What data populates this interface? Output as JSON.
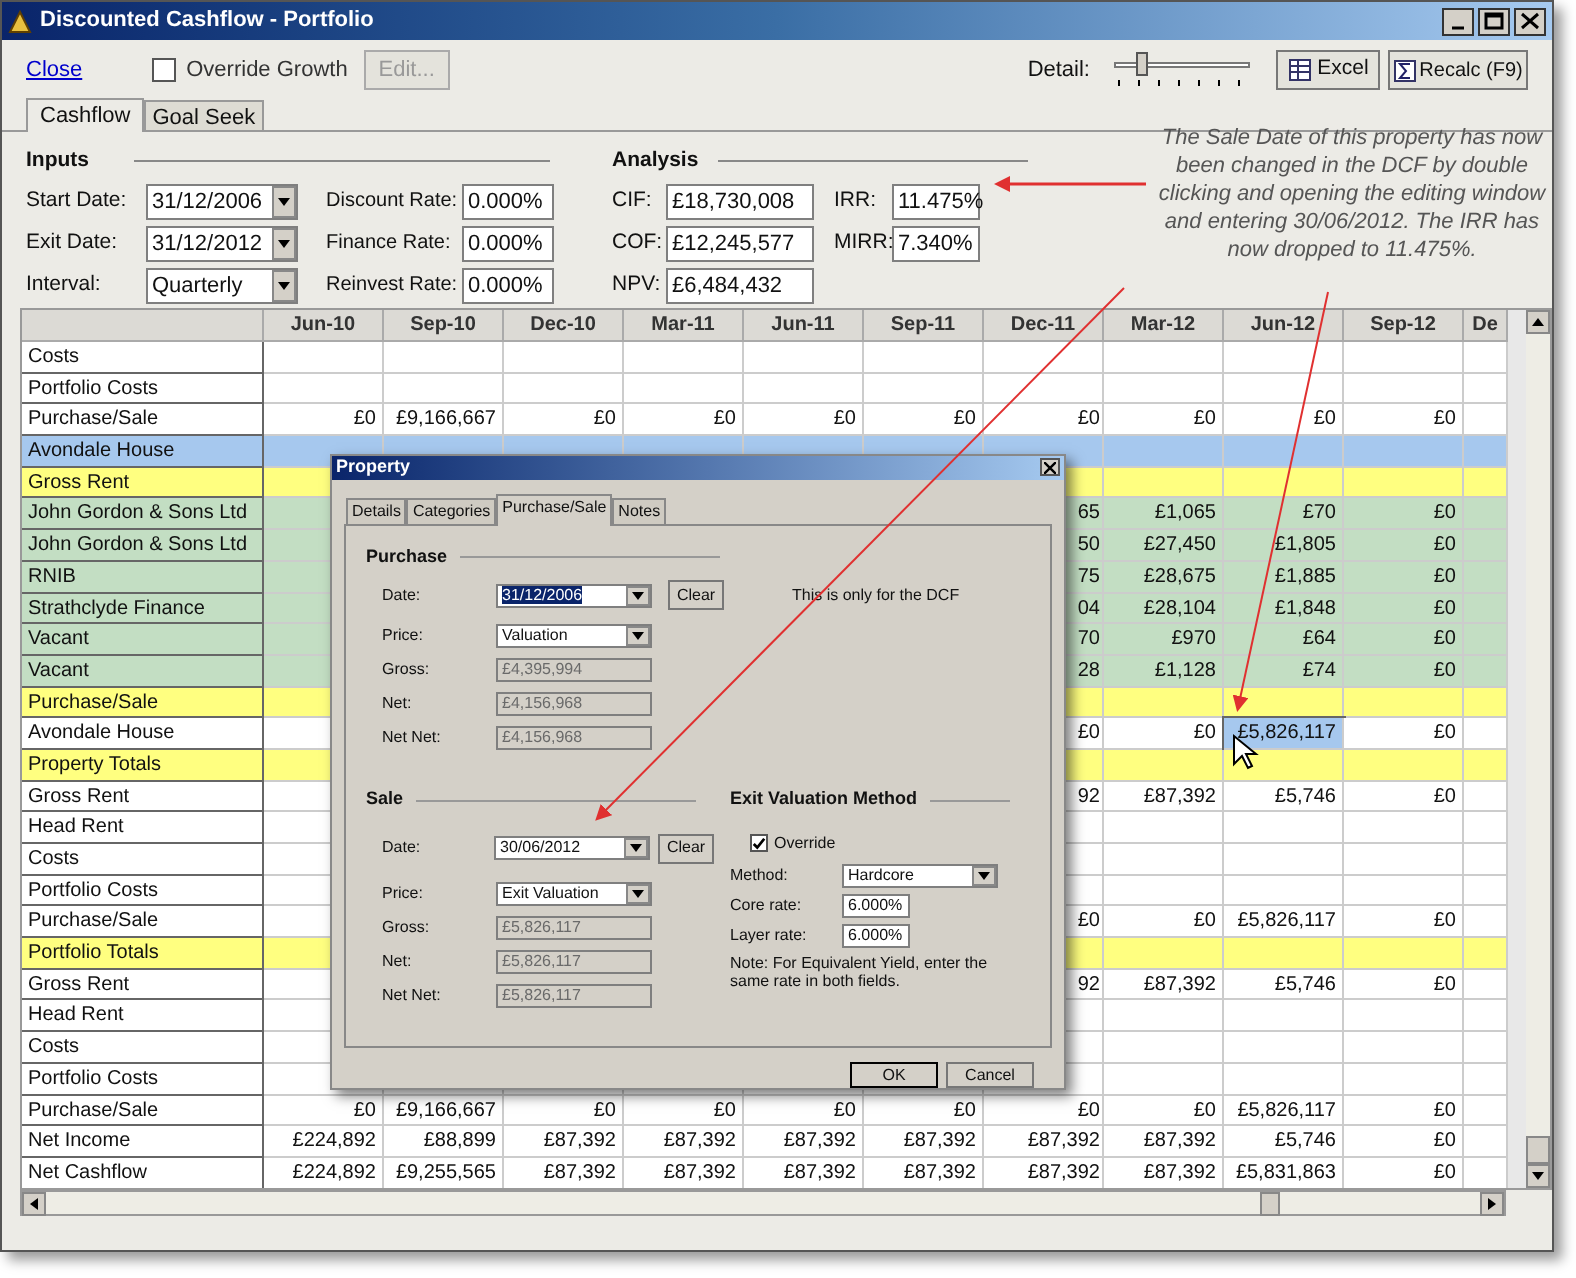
{
  "window": {
    "title": "Discounted Cashflow - Portfolio"
  },
  "toolbar": {
    "close_link": "Close",
    "override_growth": {
      "label": "Override Growth",
      "checked": false
    },
    "edit_button": {
      "label": "Edit...",
      "disabled": true
    },
    "detail_label": "Detail:",
    "detail_slider": {
      "level": 0.18
    },
    "excel_button": "Excel",
    "recalc_button": "Recalc (F9)"
  },
  "tabs": [
    {
      "label": "Cashflow",
      "selected": true
    },
    {
      "label": "Goal Seek",
      "selected": false
    }
  ],
  "inputs": {
    "heading": "Inputs",
    "dates": [
      {
        "label": "Start Date:",
        "value": "31/12/2006"
      },
      {
        "label": "Exit Date:",
        "value": "31/12/2012"
      },
      {
        "label": "Interval:",
        "value": "Quarterly"
      }
    ],
    "rates": [
      {
        "label": "Discount Rate:",
        "value": "0.000%"
      },
      {
        "label": "Finance Rate:",
        "value": "0.000%"
      },
      {
        "label": "Reinvest Rate:",
        "value": "0.000%"
      }
    ]
  },
  "analysis": {
    "heading": "Analysis",
    "left": [
      {
        "label": "CIF:",
        "value": "£18,730,008"
      },
      {
        "label": "COF:",
        "value": "£12,245,577"
      },
      {
        "label": "NPV:",
        "value": "£6,484,432"
      }
    ],
    "right": [
      {
        "label": "IRR:",
        "value": "11.475%"
      },
      {
        "label": "MIRR:",
        "value": "7.340%"
      }
    ]
  },
  "annotation": "The Sale Date of this property has now been changed in the DCF by double clicking and opening the editing window and entering 30/06/2012. The IRR has now dropped to 11.475%.",
  "grid": {
    "columns": [
      "Jun-10",
      "Sep-10",
      "Dec-10",
      "Mar-11",
      "Jun-11",
      "Sep-11",
      "Dec-11",
      "Mar-12",
      "Jun-12",
      "Sep-12",
      "De"
    ],
    "rows": [
      {
        "label": "Costs",
        "kind": "plain",
        "cells": [
          null,
          null,
          null,
          null,
          null,
          null,
          null,
          null,
          null,
          null,
          null
        ]
      },
      {
        "label": "Portfolio Costs",
        "kind": "plain",
        "cells": [
          null,
          null,
          null,
          null,
          null,
          null,
          null,
          null,
          null,
          null,
          null
        ]
      },
      {
        "label": "Purchase/Sale",
        "kind": "plain",
        "cells": [
          "£0",
          "£9,166,667",
          "£0",
          "£0",
          "£0",
          "£0",
          "£0",
          "£0",
          "£0",
          "£0",
          null
        ]
      },
      {
        "label": "Avondale House",
        "kind": "property",
        "cells": [
          null,
          null,
          null,
          null,
          null,
          null,
          null,
          null,
          null,
          null,
          null
        ]
      },
      {
        "label": "Gross Rent",
        "kind": "section",
        "cells": [
          null,
          null,
          null,
          null,
          null,
          null,
          null,
          null,
          null,
          null,
          null
        ]
      },
      {
        "label": "John Gordon & Sons Ltd",
        "kind": "tenant",
        "cells": [
          null,
          null,
          null,
          null,
          null,
          null,
          "65",
          "£1,065",
          "£70",
          "£0",
          null
        ]
      },
      {
        "label": "John Gordon & Sons Ltd",
        "kind": "tenant",
        "cells": [
          null,
          null,
          null,
          null,
          null,
          null,
          "50",
          "£27,450",
          "£1,805",
          "£0",
          null
        ]
      },
      {
        "label": "RNIB",
        "kind": "tenant",
        "cells": [
          null,
          null,
          null,
          null,
          null,
          null,
          "75",
          "£28,675",
          "£1,885",
          "£0",
          null
        ]
      },
      {
        "label": "Strathclyde Finance",
        "kind": "tenant",
        "cells": [
          null,
          null,
          null,
          null,
          null,
          null,
          "04",
          "£28,104",
          "£1,848",
          "£0",
          null
        ]
      },
      {
        "label": "Vacant",
        "kind": "tenant",
        "cells": [
          null,
          null,
          null,
          null,
          null,
          null,
          "70",
          "£970",
          "£64",
          "£0",
          null
        ]
      },
      {
        "label": "Vacant",
        "kind": "tenant",
        "cells": [
          null,
          null,
          null,
          null,
          null,
          null,
          "28",
          "£1,128",
          "£74",
          "£0",
          null
        ]
      },
      {
        "label": "Purchase/Sale",
        "kind": "section",
        "cells": [
          null,
          null,
          null,
          null,
          null,
          null,
          null,
          null,
          null,
          null,
          null
        ]
      },
      {
        "label": "Avondale House",
        "kind": "plain",
        "cells": [
          null,
          null,
          null,
          null,
          null,
          null,
          "£0",
          "£0",
          {
            "text": "£5,826,117",
            "selected": true
          },
          "£0",
          null
        ]
      },
      {
        "label": "Property Totals",
        "kind": "section",
        "cells": [
          null,
          null,
          null,
          null,
          null,
          null,
          null,
          null,
          null,
          null,
          null
        ]
      },
      {
        "label": "Gross Rent",
        "kind": "plain",
        "cells": [
          null,
          null,
          null,
          null,
          null,
          null,
          "92",
          "£87,392",
          "£5,746",
          "£0",
          null
        ]
      },
      {
        "label": "Head Rent",
        "kind": "plain",
        "cells": [
          null,
          null,
          null,
          null,
          null,
          null,
          null,
          null,
          null,
          null,
          null
        ]
      },
      {
        "label": "Costs",
        "kind": "plain",
        "cells": [
          null,
          null,
          null,
          null,
          null,
          null,
          null,
          null,
          null,
          null,
          null
        ]
      },
      {
        "label": "Portfolio Costs",
        "kind": "plain",
        "cells": [
          null,
          null,
          null,
          null,
          null,
          null,
          null,
          null,
          null,
          null,
          null
        ]
      },
      {
        "label": "Purchase/Sale",
        "kind": "plain",
        "cells": [
          null,
          null,
          null,
          null,
          null,
          null,
          "£0",
          "£0",
          "£5,826,117",
          "£0",
          null
        ]
      },
      {
        "label": "Portfolio Totals",
        "kind": "section",
        "cells": [
          null,
          null,
          null,
          null,
          null,
          null,
          null,
          null,
          null,
          null,
          null
        ]
      },
      {
        "label": "Gross Rent",
        "kind": "plain",
        "cells": [
          null,
          null,
          null,
          null,
          null,
          null,
          "92",
          "£87,392",
          "£5,746",
          "£0",
          null
        ]
      },
      {
        "label": "Head Rent",
        "kind": "plain",
        "cells": [
          null,
          null,
          null,
          null,
          null,
          null,
          null,
          null,
          null,
          null,
          null
        ]
      },
      {
        "label": "Costs",
        "kind": "plain",
        "cells": [
          null,
          null,
          null,
          null,
          null,
          null,
          null,
          null,
          null,
          null,
          null
        ]
      },
      {
        "label": "Portfolio Costs",
        "kind": "plain",
        "cells": [
          null,
          null,
          null,
          null,
          null,
          null,
          null,
          null,
          null,
          null,
          null
        ]
      },
      {
        "label": "Purchase/Sale",
        "kind": "plain",
        "cells": [
          "£0",
          "£9,166,667",
          "£0",
          "£0",
          "£0",
          "£0",
          "£0",
          "£0",
          "£5,826,117",
          "£0",
          null
        ]
      },
      {
        "label": "Net Income",
        "kind": "plain",
        "cells": [
          "£224,892",
          "£88,899",
          "£87,392",
          "£87,392",
          "£87,392",
          "£87,392",
          "£87,392",
          "£87,392",
          "£5,746",
          "£0",
          null
        ]
      },
      {
        "label": "Net Cashflow",
        "kind": "plain",
        "cells": [
          "£224,892",
          "£9,255,565",
          "£87,392",
          "£87,392",
          "£87,392",
          "£87,392",
          "£87,392",
          "£87,392",
          "£5,831,863",
          "£0",
          null
        ]
      }
    ]
  },
  "dialog": {
    "title": "Property",
    "tabs": [
      {
        "label": "Details",
        "selected": false
      },
      {
        "label": "Categories",
        "selected": false
      },
      {
        "label": "Purchase/Sale",
        "selected": true
      },
      {
        "label": "Notes",
        "selected": false
      }
    ],
    "purchase": {
      "heading": "Purchase",
      "date_label": "Date:",
      "date": "31/12/2006",
      "clear": "Clear",
      "note": "This is only for the DCF",
      "price_label": "Price:",
      "price": "Valuation",
      "amounts": [
        {
          "label": "Gross:",
          "value": "£4,395,994"
        },
        {
          "label": "Net:",
          "value": "£4,156,968"
        },
        {
          "label": "Net Net:",
          "value": "£4,156,968"
        }
      ]
    },
    "sale": {
      "heading": "Sale",
      "date_label": "Date:",
      "date": "30/06/2012",
      "clear": "Clear",
      "price_label": "Price:",
      "price": "Exit Valuation",
      "amounts": [
        {
          "label": "Gross:",
          "value": "£5,826,117"
        },
        {
          "label": "Net:",
          "value": "£5,826,117"
        },
        {
          "label": "Net Net:",
          "value": "£5,826,117"
        }
      ]
    },
    "exit": {
      "heading": "Exit Valuation Method",
      "override": {
        "label": "Override",
        "checked": true
      },
      "method_label": "Method:",
      "method": "Hardcore",
      "rates": [
        {
          "label": "Core rate:",
          "value": "6.000%"
        },
        {
          "label": "Layer rate:",
          "value": "6.000%"
        }
      ],
      "note": "Note: For Equivalent Yield, enter the same rate in both fields."
    },
    "buttons": [
      "OK",
      "Cancel"
    ]
  }
}
